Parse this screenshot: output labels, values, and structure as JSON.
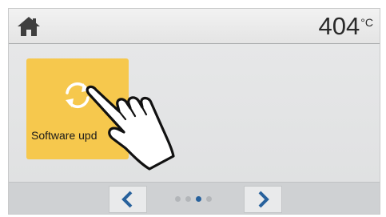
{
  "header": {
    "home_icon": "home-icon",
    "temperature": "404",
    "temperature_unit": "°C"
  },
  "tiles": [
    {
      "label": "Software upd",
      "icon": "refresh-icon",
      "color": "#f6c84d"
    }
  ],
  "pagination": {
    "prev_icon": "chevron-left-icon",
    "next_icon": "chevron-right-icon",
    "total_pages": 4,
    "current_page": 3
  },
  "overlay": {
    "icon": "pointing-hand-icon"
  },
  "colors": {
    "accent": "#27619c",
    "tile": "#f6c84d",
    "header_icon": "#3f3f3f"
  }
}
